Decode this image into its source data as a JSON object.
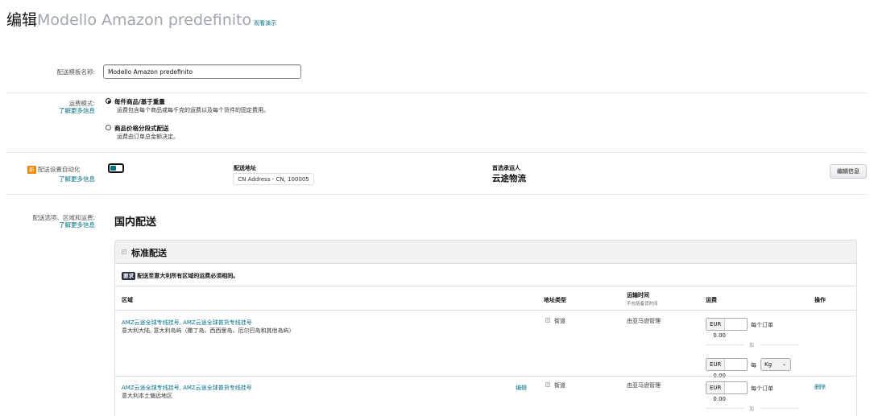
{
  "header": {
    "prefix": "编辑",
    "template_name": "Modello Amazon predefinito",
    "demo_link": "观看演示"
  },
  "template_name_field": {
    "label": "配送模板名称:",
    "value": "Modello Amazon predefinito"
  },
  "shipping_mode": {
    "label": "运费模式:",
    "learn_more": "了解更多信息",
    "options": [
      {
        "title": "每件商品/基于重量",
        "desc": "运费包含每个商品或每千克的运费以及每个货件的固定费用。",
        "selected": true
      },
      {
        "title": "商品价格分段式配送",
        "desc": "运费由订单总金额决定。",
        "selected": false
      }
    ]
  },
  "automation": {
    "new_badge": "新",
    "label": "配送设置自动化",
    "learn_more": "了解更多信息",
    "enabled": true,
    "address_label": "配送地址",
    "address_value": "CN Address - CN, 100005",
    "carrier_label": "首选承运人",
    "carrier_value": "云途物流",
    "edit_button": "编辑信息"
  },
  "options_section": {
    "label": "配送选项、区域和运费:",
    "learn_more": "了解更多信息",
    "heading": "国内配送",
    "standard_label": "标准配送",
    "requirement_badge": "要求",
    "requirement_text": "配送至意大利所有区域的运费必须相同。",
    "columns": {
      "region": "区域",
      "address_type": "地址类型",
      "transit_time": "运输时间",
      "transit_sub": "不包括备货时间",
      "fee": "运费",
      "action": "操作"
    },
    "rows": [
      {
        "carriers": "AMZ云途全球专线挂号, AMZ云途全球普货专线挂号",
        "regions": "意大利大陆, 意大利岛屿（撒丁岛、西西里岛、厄尔巴岛和其他岛屿）",
        "edit": "",
        "address_type": "街道",
        "transit": "由亚马逊管理",
        "currency": "EUR",
        "per_order": "0.00",
        "per_order_label": "每个订单",
        "plus": "加",
        "currency2": "EUR",
        "per_unit": "0.00",
        "per_label": "每",
        "unit": "Kg",
        "delete": ""
      },
      {
        "carriers": "AMZ云途全球专线挂号, AMZ云途全球普货专线挂号",
        "regions": "意大利本土偏远地区",
        "edit": "编辑",
        "address_type": "街道",
        "transit": "由亚马逊管理",
        "currency": "EUR",
        "per_order": "0.00",
        "per_order_label": "每个订单",
        "plus": "加",
        "delete": "删除"
      }
    ]
  }
}
